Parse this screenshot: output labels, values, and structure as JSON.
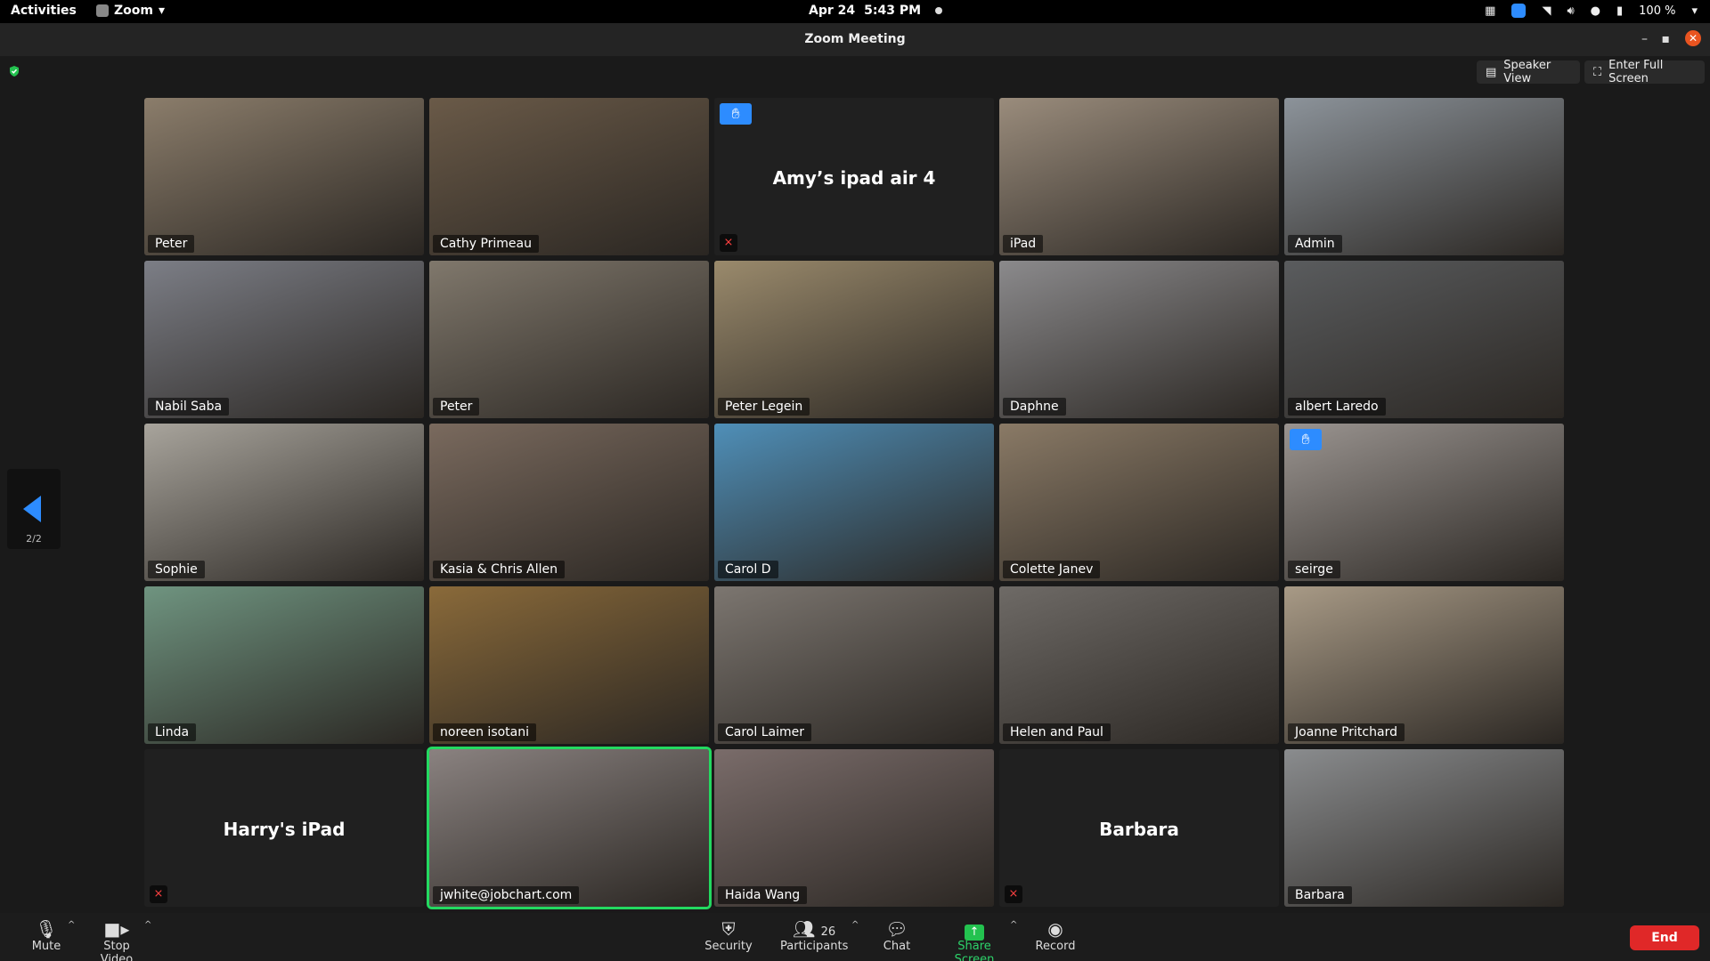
{
  "topbar": {
    "activities": "Activities",
    "app_name": "Zoom",
    "date": "Apr 24",
    "time": "5:43 PM",
    "battery": "100 %"
  },
  "window": {
    "title": "Zoom Meeting",
    "speaker_view": "Speaker View",
    "full_screen": "Enter Full Screen"
  },
  "pager": {
    "page": "2/2"
  },
  "tiles": [
    {
      "name": "Peter",
      "bg": "#8b7d6b"
    },
    {
      "name": "Cathy Primeau",
      "bg": "#6a5a48"
    },
    {
      "name": "",
      "center": "Amy’s ipad air 4",
      "hand": true,
      "muted": true
    },
    {
      "name": "iPad",
      "bg": "#9a8c7c"
    },
    {
      "name": "Admin",
      "bg": "#8c939a"
    },
    {
      "name": "Nabil Saba",
      "bg": "#7c7e86"
    },
    {
      "name": "Peter",
      "bg": "#80786c"
    },
    {
      "name": "Peter Legein",
      "bg": "#9a8a6c"
    },
    {
      "name": "Daphne",
      "bg": "#8b8a8c"
    },
    {
      "name": "albert Laredo",
      "bg": "#5a5c5e"
    },
    {
      "name": "Sophie",
      "bg": "#a8a49c"
    },
    {
      "name": "Kasia & Chris Allen",
      "bg": "#7a6a5e"
    },
    {
      "name": "Carol D",
      "bg": "#4f8fb8"
    },
    {
      "name": "Colette Janev",
      "bg": "#8a7a66"
    },
    {
      "name": "seirge",
      "bg": "#9a9490",
      "hand": true
    },
    {
      "name": "Linda",
      "bg": "#6f9480"
    },
    {
      "name": "noreen isotani",
      "bg": "#8a6a3a"
    },
    {
      "name": "Carol Laimer",
      "bg": "#7c7670"
    },
    {
      "name": "Helen and Paul",
      "bg": "#6e6a66"
    },
    {
      "name": "Joanne Pritchard",
      "bg": "#a89a86"
    },
    {
      "name": "",
      "center": "Harry's iPad",
      "muted": true
    },
    {
      "name": "jwhite@jobchart.com",
      "bg": "#8a8280",
      "active": true
    },
    {
      "name": "Haida Wang",
      "bg": "#7a6c6a"
    },
    {
      "name": "",
      "center": "Barbara",
      "muted": true
    },
    {
      "name": "Barbara",
      "bg": "#8a8c8e"
    }
  ],
  "toolbar": {
    "mute": "Mute",
    "stop_video": "Stop Video",
    "security": "Security",
    "participants": "Participants",
    "participants_count": "26",
    "chat": "Chat",
    "share_screen": "Share Screen",
    "record": "Record",
    "end": "End"
  }
}
